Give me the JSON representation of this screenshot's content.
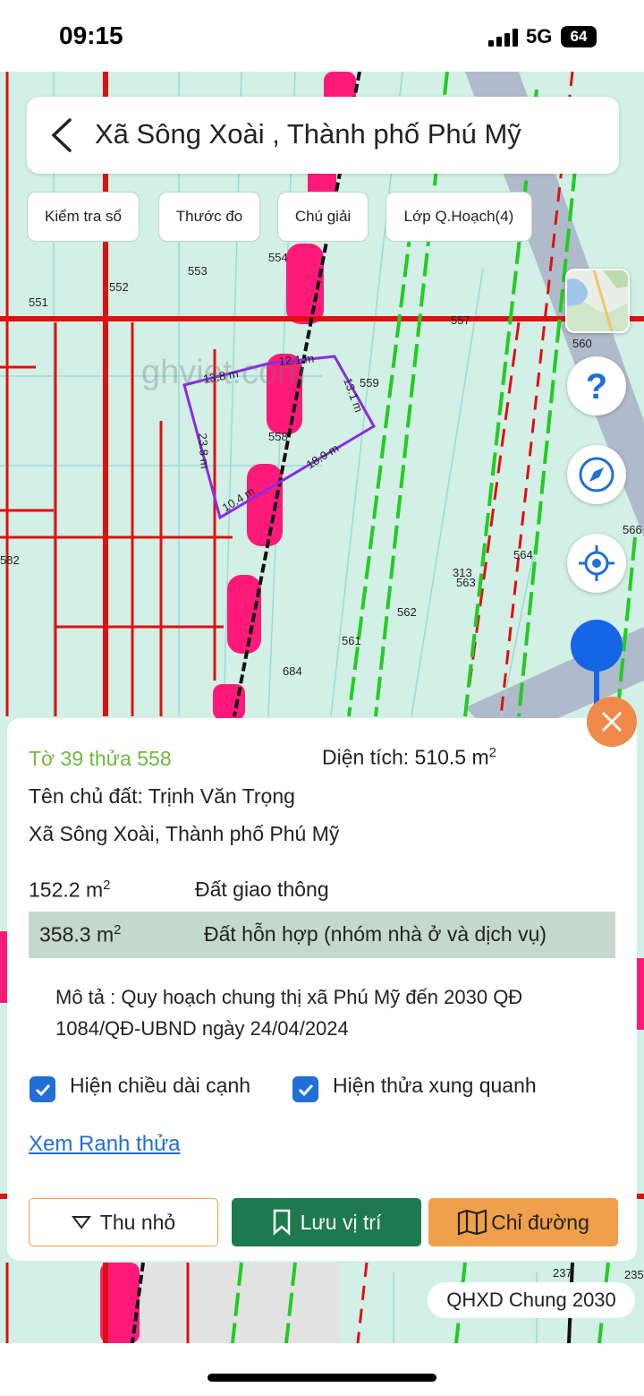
{
  "status_bar": {
    "time": "09:15",
    "network": "5G",
    "battery": "64"
  },
  "header": {
    "title": "Xã Sông Xoài , Thành phố Phú Mỹ",
    "back_icon": "chevron-left-icon"
  },
  "toolbar": {
    "chips": [
      "Kiểm tra sổ",
      "Thước đo",
      "Chú giải",
      "Lớp Q.Hoạch(4)"
    ]
  },
  "map": {
    "parcel_numbers": [
      "551",
      "552",
      "553",
      "554",
      "557",
      "560",
      "559",
      "558",
      "566",
      "582",
      "564",
      "313",
      "563",
      "562",
      "561",
      "684",
      "237",
      "235"
    ],
    "edge_lengths": [
      "13.8 m",
      "12.1 m",
      "13.1 m",
      "23.8 m",
      "18.9 m",
      "10.4 m"
    ],
    "plan_label": "QHXD Chung 2030",
    "colors": {
      "background": "#d2f0e6",
      "boundary_red": "#e01010",
      "pink_zone": "#ff1a7a",
      "green_line": "#22cc22",
      "selection": "#8a2be2"
    }
  },
  "controls": {
    "help_icon": "question-mark-icon",
    "compass_icon": "compass-icon",
    "locate_icon": "crosshair-icon",
    "close_icon": "close-icon"
  },
  "info": {
    "parcel_id": "Tờ 39 thửa 558",
    "area_label": "Diện tích: 510.5 m",
    "area_sup": "2",
    "owner": "Tên chủ đất: Trịnh Văn Trọng",
    "address": "Xã Sông Xoài, Thành phố Phú Mỹ",
    "land_uses": [
      {
        "area": "152.2 m",
        "sup": "2",
        "type": "Đất giao thông"
      },
      {
        "area": "358.3 m",
        "sup": "2",
        "type": "Đất hỗn hợp (nhóm nhà ở và dịch vụ)"
      }
    ],
    "description": "Mô tả : Quy hoạch chung thị xã Phú Mỹ đến 2030 QĐ 1084/QĐ-UBND ngày 24/04/2024",
    "checkbox_edges": "Hiện chiều dài cạnh",
    "checkbox_neighbors": "Hiện thửa xung quanh",
    "checkbox_edges_checked": true,
    "checkbox_neighbors_checked": true,
    "view_boundary_link": "Xem Ranh thửa"
  },
  "actions": {
    "collapse": "Thu nhỏ",
    "save_location": "Lưu vị trí",
    "directions": "Chỉ đường",
    "colors": {
      "save": "#1e7a4e",
      "directions": "#f0a04b"
    }
  }
}
